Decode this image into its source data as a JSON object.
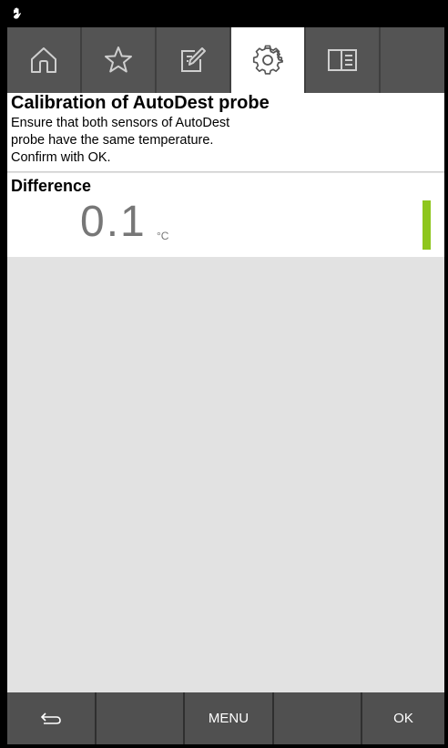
{
  "status_bar": {
    "icon": "hand-icon"
  },
  "tabs": [
    {
      "name": "home",
      "icon": "home-icon",
      "active": false
    },
    {
      "name": "favorites",
      "icon": "star-icon",
      "active": false
    },
    {
      "name": "edit",
      "icon": "edit-icon",
      "active": false
    },
    {
      "name": "settings",
      "icon": "gear-icon",
      "active": true
    },
    {
      "name": "manual",
      "icon": "book-icon",
      "active": false
    },
    {
      "name": "empty",
      "icon": "",
      "active": false
    }
  ],
  "header": {
    "title": "Calibration of AutoDest probe",
    "description_lines": [
      "Ensure that both sensors of AutoDest",
      "probe have the same temperature.",
      "Confirm with OK."
    ]
  },
  "difference": {
    "label": "Difference",
    "value": "0.1",
    "unit": "°C",
    "indicator_color": "#8ec61c"
  },
  "bottom_bar": {
    "back_icon": "back-arrow-icon",
    "menu_label": "MENU",
    "ok_label": "OK"
  }
}
